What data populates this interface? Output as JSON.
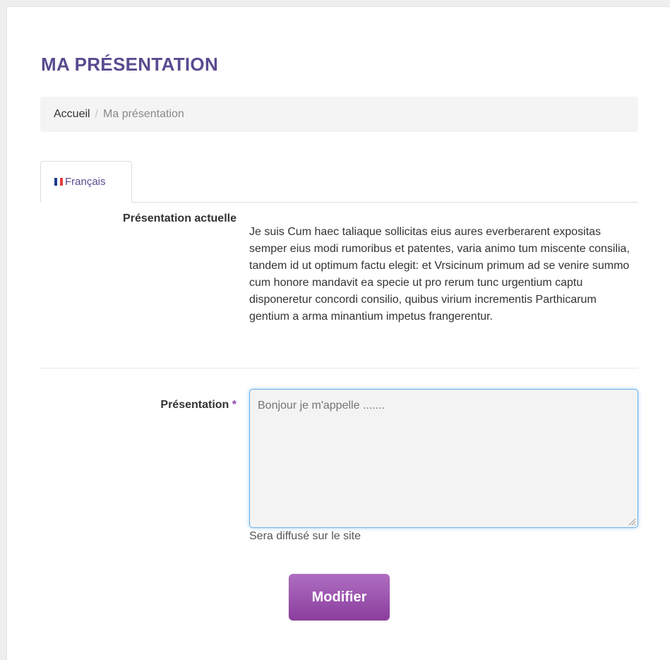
{
  "header": {
    "title": "MA PRÉSENTATION"
  },
  "breadcrumb": {
    "home": "Accueil",
    "separator": "/",
    "current": "Ma présentation"
  },
  "tabs": [
    {
      "label": "Français",
      "icon": "flag-fr-icon",
      "active": true
    }
  ],
  "current_presentation": {
    "label": "Présentation actuelle",
    "text": "Je suis Cum haec taliaque sollicitas eius aures everberarent expositas semper eius modi rumoribus et patentes, varia animo tum miscente consilia, tandem id ut optimum factu elegit: et Vrsicinum primum ad se venire summo cum honore mandavit ea specie ut pro rerum tunc urgentium captu disponeretur concordi consilio, quibus virium incrementis Parthicarum gentium a arma minantium impetus frangerentur."
  },
  "form": {
    "label": "Présentation",
    "required_mark": "*",
    "value": "",
    "placeholder": "Bonjour je m'appelle .......",
    "help": "Sera diffusé sur le site",
    "submit_label": "Modifier"
  },
  "colors": {
    "title": "#5b4a8f",
    "accent": "#8b3d9e",
    "focus_border": "#66afe9"
  }
}
